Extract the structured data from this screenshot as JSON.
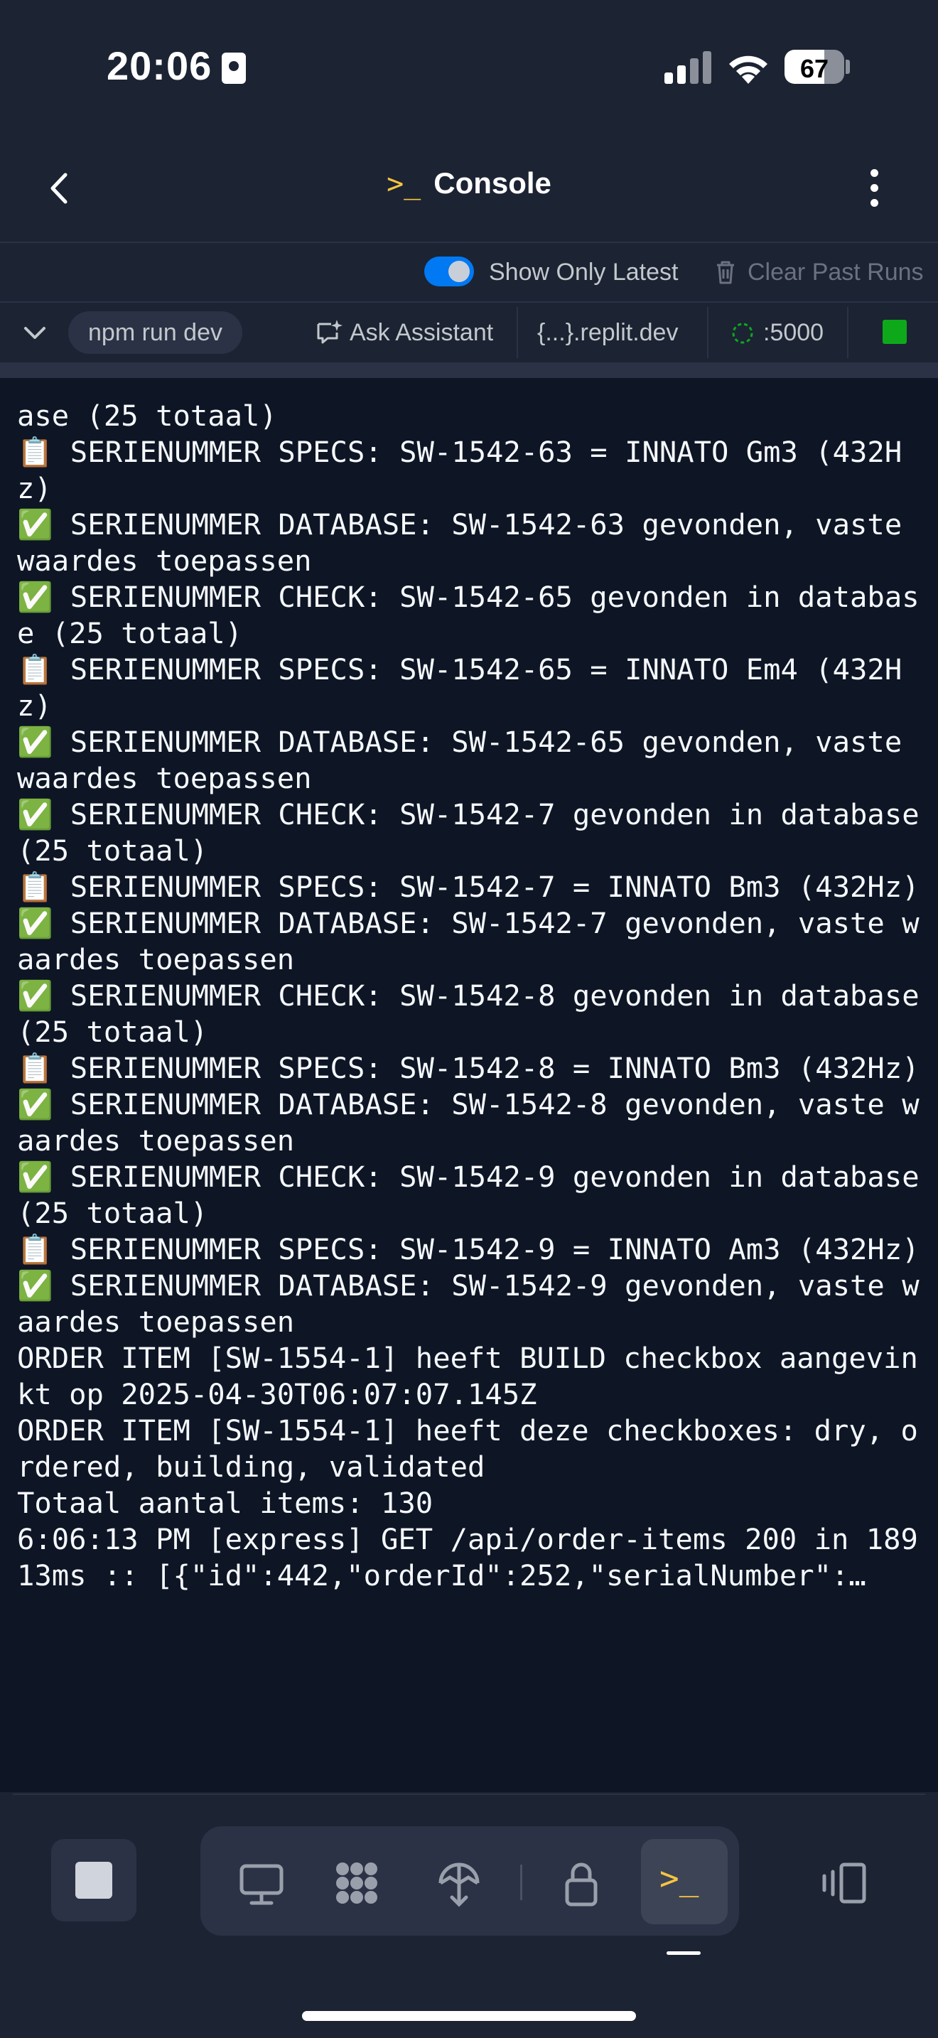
{
  "status": {
    "time": "20:06",
    "battery_level": "67",
    "battery_fraction": 0.67
  },
  "header": {
    "title": "Console"
  },
  "options": {
    "show_latest_label": "Show Only Latest",
    "show_latest_on": true,
    "clear_label": "Clear Past Runs"
  },
  "tabs": {
    "command": "npm run dev",
    "ask_assistant": "Ask Assistant",
    "domain": "{...}.replit.dev",
    "port": ":5000"
  },
  "console": {
    "lines": [
      "ase (25 totaal)",
      "📋 SERIENUMMER SPECS: SW-1542-63 = INNATO Gm3 (432Hz)",
      "✅ SERIENUMMER DATABASE: SW-1542-63 gevonden, vaste waardes toepassen",
      "✅ SERIENUMMER CHECK: SW-1542-65 gevonden in database (25 totaal)",
      "📋 SERIENUMMER SPECS: SW-1542-65 = INNATO Em4 (432Hz)",
      "✅ SERIENUMMER DATABASE: SW-1542-65 gevonden, vaste waardes toepassen",
      "✅ SERIENUMMER CHECK: SW-1542-7 gevonden in database (25 totaal)",
      "📋 SERIENUMMER SPECS: SW-1542-7 = INNATO Bm3 (432Hz)",
      "✅ SERIENUMMER DATABASE: SW-1542-7 gevonden, vaste waardes toepassen",
      "✅ SERIENUMMER CHECK: SW-1542-8 gevonden in database (25 totaal)",
      "📋 SERIENUMMER SPECS: SW-1542-8 = INNATO Bm3 (432Hz)",
      "✅ SERIENUMMER DATABASE: SW-1542-8 gevonden, vaste waardes toepassen",
      "✅ SERIENUMMER CHECK: SW-1542-9 gevonden in database (25 totaal)",
      "📋 SERIENUMMER SPECS: SW-1542-9 = INNATO Am3 (432Hz)",
      "✅ SERIENUMMER DATABASE: SW-1542-9 gevonden, vaste waardes toepassen",
      "ORDER ITEM [SW-1554-1] heeft BUILD checkbox aangevinkt op 2025-04-30T06:07:07.145Z",
      "ORDER ITEM [SW-1554-1] heeft deze checkboxes: dry, ordered, building, validated",
      "Totaal aantal items: 130",
      "6:06:13 PM [express] GET /api/order-items 200 in 18913ms :: [{\"id\":442,\"orderId\":252,\"serialNumber\":…"
    ]
  },
  "dock": {
    "tools": [
      "stop-icon",
      "desktop-icon",
      "workflows-icon",
      "deployments-icon",
      "secrets-icon",
      "console-icon",
      "panel-toggle-icon"
    ]
  },
  "colors": {
    "background": "#1c2333",
    "console_bg": "#0e1525",
    "accent_blue": "#0079f2",
    "accent_yellow": "#f5c542",
    "running_green": "#0ea91b"
  }
}
